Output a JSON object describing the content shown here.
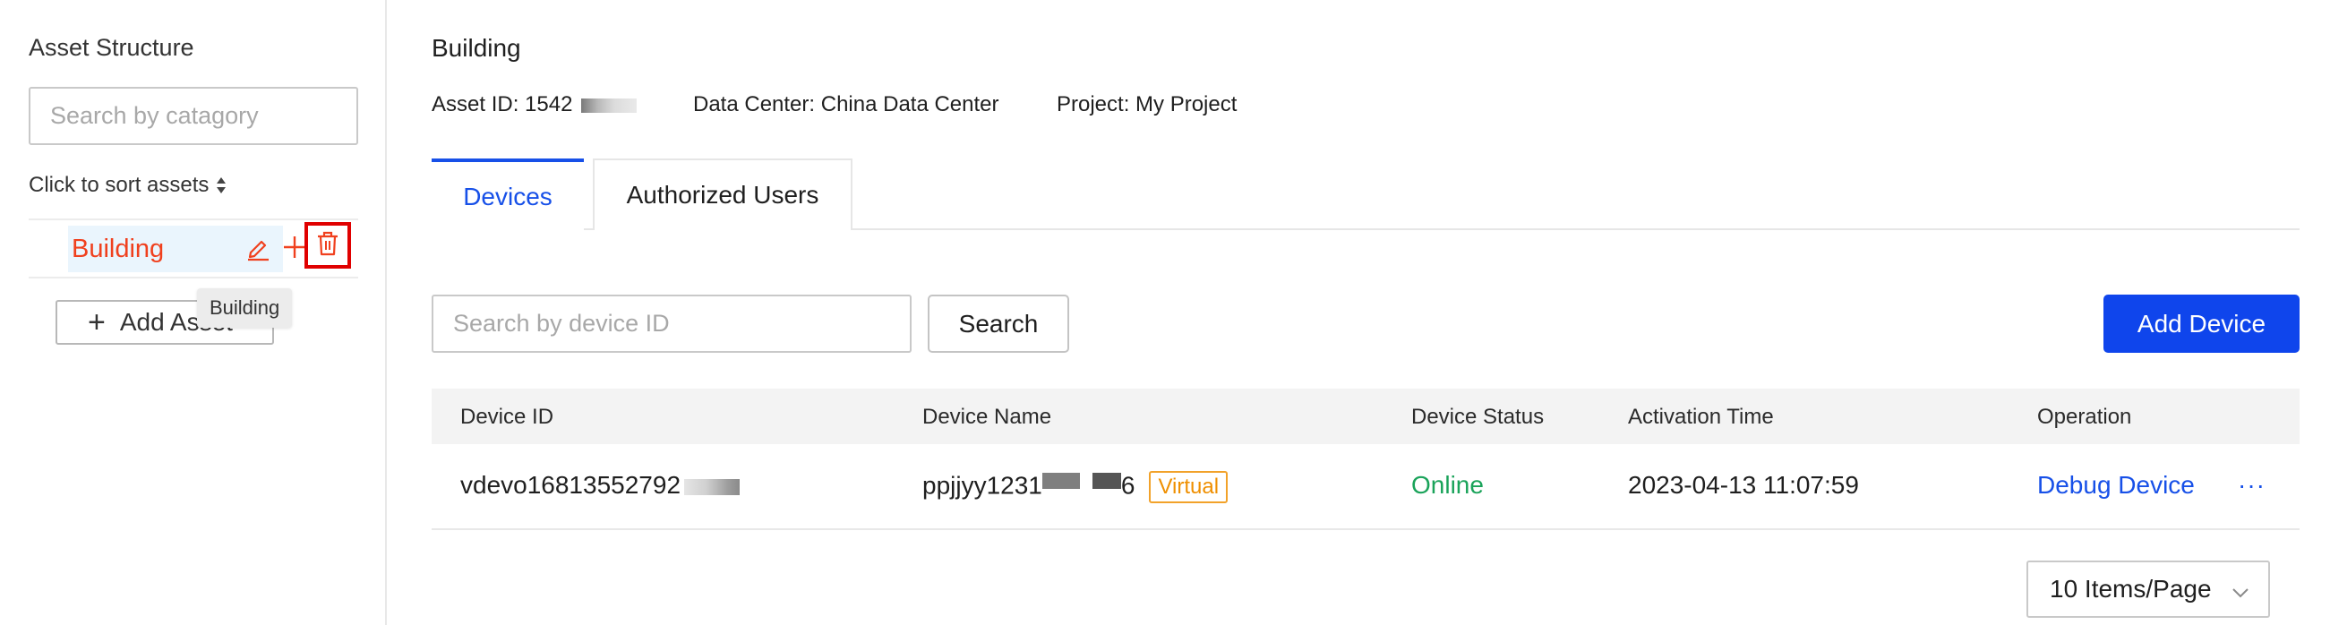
{
  "sidebar": {
    "title": "Asset Structure",
    "search_placeholder": "Search by catagory",
    "sort_label": "Click to sort assets",
    "tree": [
      {
        "label": "Building",
        "selected": true
      }
    ],
    "add_asset_label": "Add Asset",
    "tooltip": "Building"
  },
  "header": {
    "title": "Building",
    "asset_id": "Asset ID: 1542",
    "data_center": "Data Center: China Data Center",
    "project": "Project: My Project"
  },
  "tabs": [
    {
      "label": "Devices",
      "active": true
    },
    {
      "label": "Authorized Users",
      "active": false
    }
  ],
  "toolbar": {
    "search_placeholder": "Search by device ID",
    "search_label": "Search",
    "add_device_label": "Add Device"
  },
  "table": {
    "columns": [
      "Device ID",
      "Device Name",
      "Device Status",
      "Activation Time",
      "Operation"
    ],
    "rows": [
      {
        "device_id": "vdevo16813552792",
        "device_name_start": "ppjjyy1231",
        "device_name_end": "6",
        "tag": "Virtual",
        "status": "Online",
        "activation_time": "2023-04-13 11:07:59",
        "operation": "Debug Device",
        "more": "···"
      }
    ]
  },
  "pagination": {
    "page_size": "10 Items/Page"
  },
  "colors": {
    "accent": "#0f45ec",
    "tree_selected_text": "#f0401e",
    "online": "#1aa35a",
    "virtual_tag": "#ef8f00",
    "highlight_box": "#e00000"
  },
  "icons": [
    "sort-icon",
    "edit-icon",
    "plus-icon",
    "trash-icon",
    "chevron-down-icon",
    "more-icon"
  ]
}
